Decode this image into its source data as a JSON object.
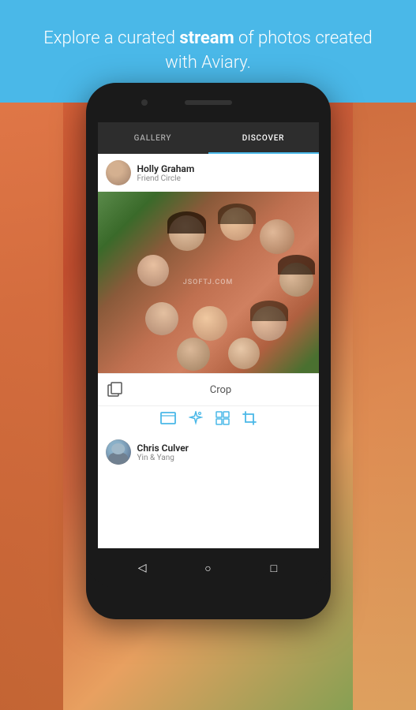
{
  "banner": {
    "text_normal": "Explore a curated ",
    "text_bold": "stream",
    "text_suffix": " of photos created with Aviary."
  },
  "app": {
    "tabs": [
      {
        "id": "gallery",
        "label": "GALLERY",
        "active": false
      },
      {
        "id": "discover",
        "label": "DISCOVER",
        "active": true
      }
    ]
  },
  "posts": [
    {
      "id": "post-1",
      "username": "Holly Graham",
      "circle": "Friend Circle",
      "image_alt": "Group of friends lying in a circle",
      "watermark": "JSOFTJ.COM",
      "action_label": "Crop",
      "tools": [
        "crop-aspect-icon",
        "enhance-icon",
        "frames-icon",
        "crop-icon"
      ]
    },
    {
      "id": "post-2",
      "username": "Chris Culver",
      "circle": "Yin & Yang"
    }
  ],
  "nav": {
    "back_icon": "◁",
    "home_icon": "○",
    "recents_icon": "□"
  },
  "colors": {
    "accent": "#4ab8e8",
    "dark": "#2d2d2d",
    "text_primary": "#222222",
    "text_secondary": "#888888"
  }
}
